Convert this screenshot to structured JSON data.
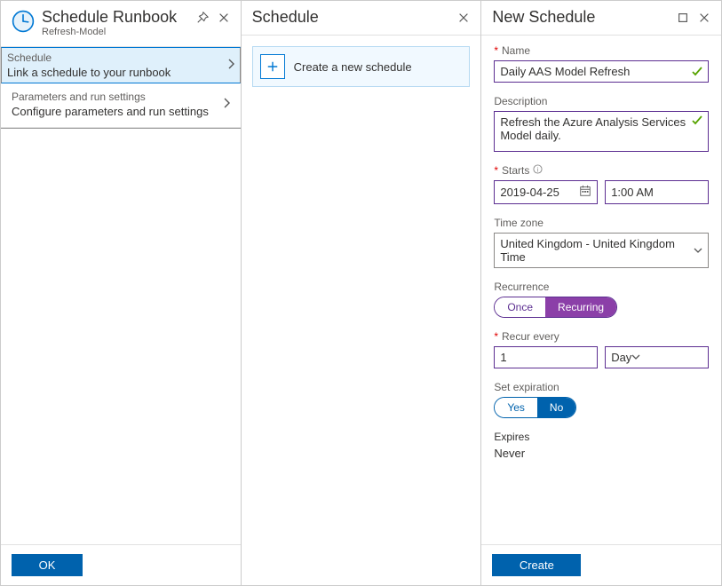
{
  "blade1": {
    "title": "Schedule Runbook",
    "subtitle": "Refresh-Model",
    "row_schedule": {
      "t1": "Schedule",
      "t2": "Link a schedule to your runbook"
    },
    "row_params": {
      "t1": "Parameters and run settings",
      "t2": "Configure parameters and run settings"
    },
    "ok": "OK"
  },
  "blade2": {
    "title": "Schedule",
    "create": "Create a new schedule"
  },
  "blade3": {
    "title": "New Schedule",
    "name": {
      "label": "Name",
      "value": "Daily AAS Model Refresh"
    },
    "description": {
      "label": "Description",
      "value": "Refresh the Azure Analysis Services Model daily."
    },
    "starts": {
      "label": "Starts",
      "date": "2019-04-25",
      "time": "1:00 AM"
    },
    "timezone": {
      "label": "Time zone",
      "value": "United Kingdom - United Kingdom Time"
    },
    "recurrence": {
      "label": "Recurrence",
      "once": "Once",
      "recurring": "Recurring"
    },
    "recur_every": {
      "label": "Recur every",
      "value": "1",
      "unit": "Day"
    },
    "set_expiration": {
      "label": "Set expiration",
      "yes": "Yes",
      "no": "No"
    },
    "expires": {
      "label": "Expires",
      "value": "Never"
    },
    "create": "Create"
  }
}
